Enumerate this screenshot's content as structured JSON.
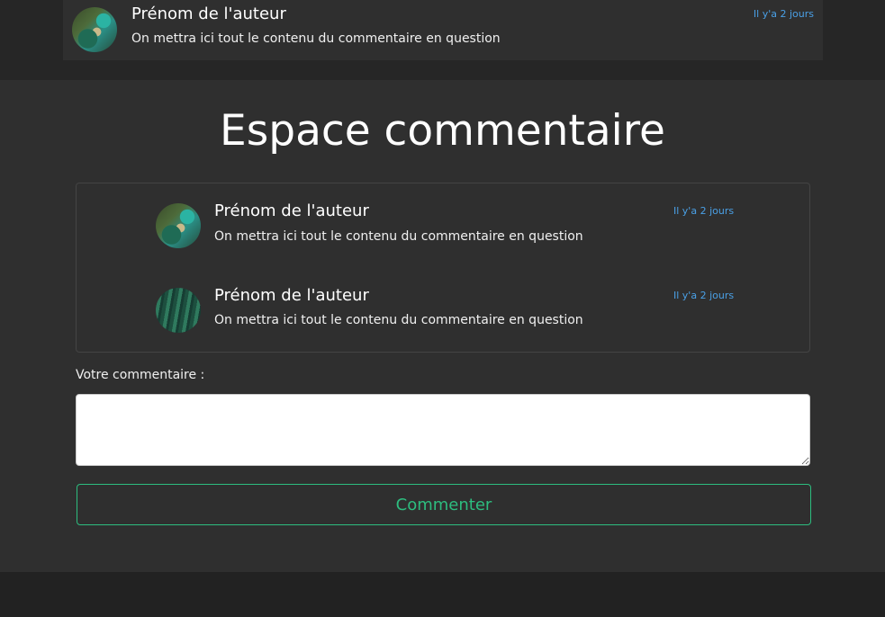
{
  "top_comment": {
    "author": "Prénom de l'auteur",
    "text": "On mettra ici tout le contenu du commentaire en question",
    "time": "Il y'a 2 jours"
  },
  "section": {
    "title": "Espace commentaire"
  },
  "comments": [
    {
      "author": "Prénom de l'auteur",
      "text": "On mettra ici tout le contenu du commentaire en question",
      "time": "Il y'a 2 jours"
    },
    {
      "author": "Prénom de l'auteur",
      "text": "On mettra ici tout le contenu du commentaire en question",
      "time": "Il y'a 2 jours"
    }
  ],
  "form": {
    "label": "Votre commentaire :",
    "value": "",
    "submit_label": "Commenter"
  },
  "colors": {
    "accent_green": "#2dbd7f",
    "time_blue": "#4aa0e6"
  }
}
